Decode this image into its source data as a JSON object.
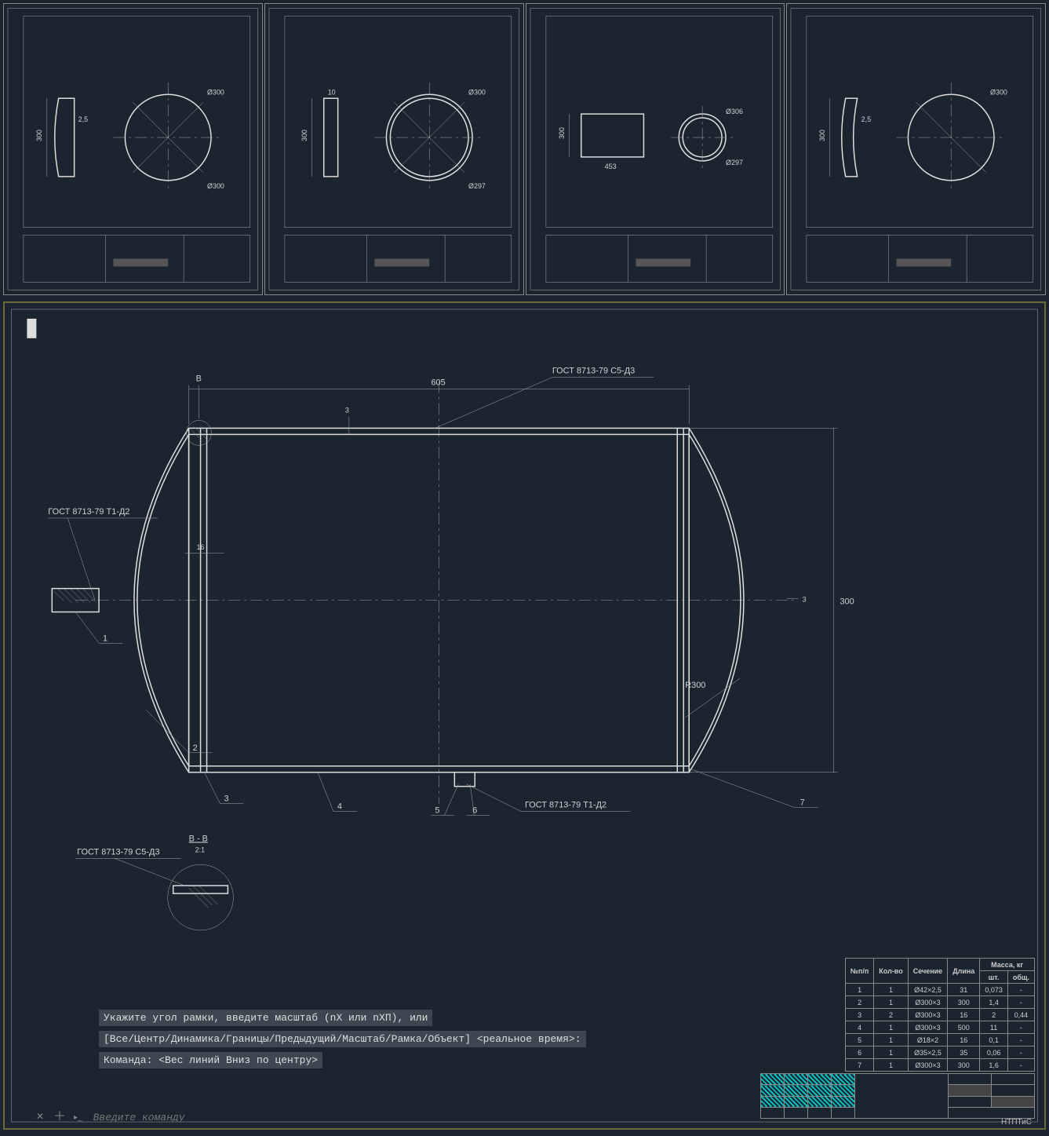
{
  "thumbnails": [
    {
      "dims": [
        "300",
        "2,5",
        "Ø300",
        "Ø300"
      ]
    },
    {
      "dims": [
        "300",
        "10",
        "Ø300",
        "Ø297"
      ]
    },
    {
      "dims": [
        "300",
        "453",
        "Ø306",
        "Ø297"
      ]
    },
    {
      "dims": [
        "300",
        "2,5",
        "Ø300"
      ]
    }
  ],
  "main_drawing": {
    "callouts": {
      "gost_top": "ГОСТ 8713-79 С5-Д3",
      "gost_left": "ГОСТ 8713-79 Т1-Д2",
      "gost_bottom": "ГОСТ 8713-79 Т1-Д2",
      "gost_detail": "ГОСТ 8713-79 С5-Д3",
      "section_label": "В - В",
      "section_scale": "2:1",
      "view_marker": "В"
    },
    "dimensions": {
      "length_605": "605",
      "height_300": "300",
      "radius_r300": "R300",
      "thickness_16": "16",
      "thickness_3_top": "3",
      "thickness_3_right": "3"
    },
    "balloons": [
      "1",
      "2",
      "3",
      "4",
      "5",
      "6",
      "7"
    ]
  },
  "spec_table": {
    "headers": [
      "№п/п",
      "Кол-во",
      "Сечение",
      "Длина",
      "шт.",
      "общ."
    ],
    "mass_header": "Масса, кг",
    "rows": [
      [
        "1",
        "1",
        "Ø42×2,5",
        "31",
        "0,073",
        "-"
      ],
      [
        "2",
        "1",
        "Ø300×3",
        "300",
        "1,4",
        "-"
      ],
      [
        "3",
        "2",
        "Ø300×3",
        "16",
        "2",
        "0,44"
      ],
      [
        "4",
        "1",
        "Ø300×3",
        "500",
        "11",
        "-"
      ],
      [
        "5",
        "1",
        "Ø18×2",
        "16",
        "0,1",
        "-"
      ],
      [
        "6",
        "1",
        "Ø35×2,5",
        "35",
        "0,06",
        "-"
      ],
      [
        "7",
        "1",
        "Ø300×3",
        "300",
        "1,6",
        "-"
      ]
    ]
  },
  "title_block": {
    "corner_label": "НТПТиС"
  },
  "command": {
    "line1": "Укажите угол рамки, введите масштаб (nX или nXП), или",
    "line2": "[Все/Центр/Динамика/Границы/Предыдущий/Масштаб/Рамка/Объект] <реальное время>:",
    "line3": "Команда:  <Вес линий Вниз по центру>",
    "input_placeholder": "Введите команду"
  }
}
